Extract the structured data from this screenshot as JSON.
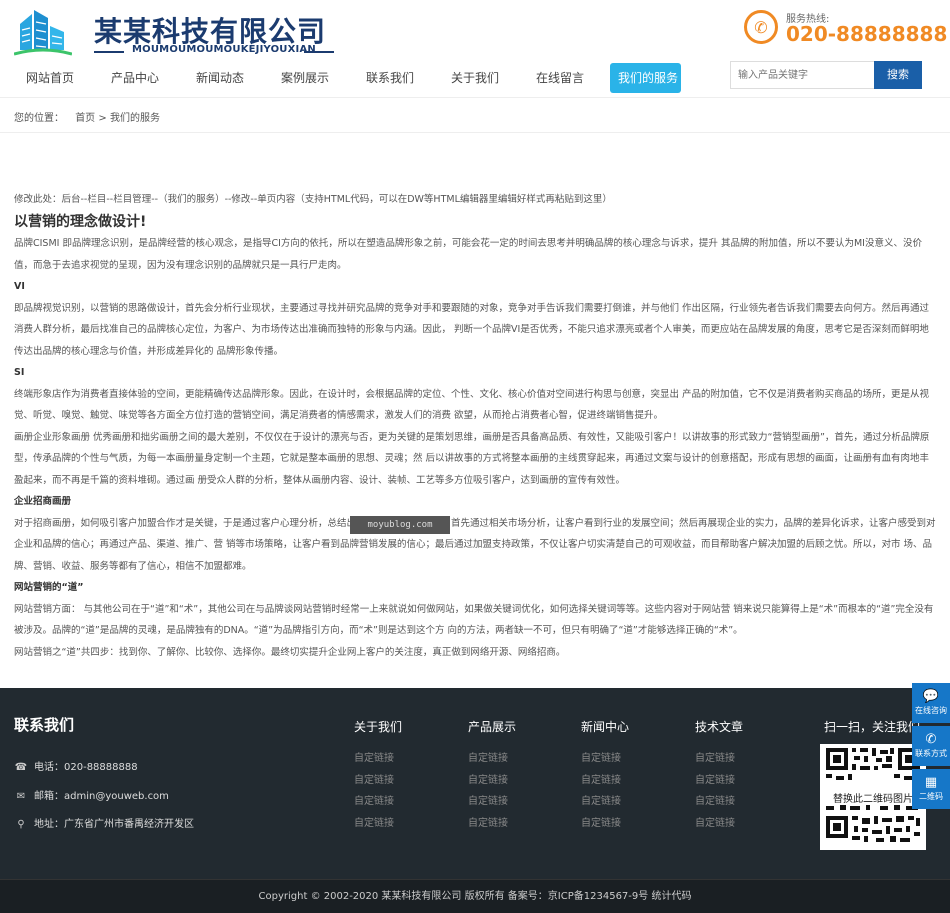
{
  "brand": {
    "title": "某某科技有限公司",
    "subtitle": "MOUMOUMOUMOUKEJIYOUXIAN",
    "logo_icon": "building-logo-icon"
  },
  "hotline": {
    "label": "服务热线:",
    "number": "020-88888888",
    "icon": "phone-icon",
    "color": "#f08a24"
  },
  "nav": {
    "items": [
      {
        "label": "网站首页"
      },
      {
        "label": "产品中心"
      },
      {
        "label": "新闻动态"
      },
      {
        "label": "案例展示"
      },
      {
        "label": "联系我们"
      },
      {
        "label": "关于我们"
      },
      {
        "label": "在线留言"
      },
      {
        "label": "我们的服务",
        "active": true
      }
    ],
    "active_color": "#2ab3e8"
  },
  "search": {
    "placeholder": "输入产品关键字",
    "button": "搜索",
    "button_color": "#1a5fa8"
  },
  "breadcrumb": {
    "prefix": "您的位置：",
    "home": "首页",
    "sep": ">",
    "current": "我们的服务"
  },
  "content": {
    "note": "修改此处：后台--栏目--栏目管理--（我们的服务）--修改--单页内容（支持HTML代码，可以在DW等HTML编辑器里编辑好样式再粘贴到这里）",
    "title": "以营销的理念做设计!",
    "p1": "品牌CISMI 即品牌理念识别，是品牌经营的核心观念，是指导CI方向的依托，所以在塑造品牌形象之前，可能会花一定的时间去思考并明确品牌的核心理念与诉求，提升 其品牌的附加值，所以不要认为MI没意义、没价值，而急于去追求视觉的呈现，因为没有理念识别的品牌就只是一具行尸走肉。",
    "h_vi": "VI",
    "p2": "即品牌视觉识别，以营销的思路做设计，首先会分析行业现状，主要通过寻找并研究品牌的竞争对手和要跟随的对象，竞争对手告诉我们需要打倒谁，并与他们 作出区隔，行业领先者告诉我们需要去向何方。然后再通过消费人群分析，最后找准自己的品牌核心定位，为客户、为市场传达出准确而独特的形象与内涵。因此， 判断一个品牌VI是否优秀，不能只追求漂亮或者个人审美，而更应站在品牌发展的角度，思考它是否深刻而鲜明地传达出品牌的核心理念与价值，并形成差异化的 品牌形象传播。",
    "h_si": "SI",
    "p3": "终端形象店作为消费者直接体验的空间，更能精确传达品牌形象。因此，在设计时，会根据品牌的定位、个性、文化、核心价值对空间进行构思与创意，突显出 产品的附加值，它不仅是消费者购买商品的场所，更是从视觉、听觉、嗅觉、触觉、味觉等各方面全方位打造的营销空间，满足消费者的情感需求，激发人们的消费 欲望，从而抢占消费者心智，促进终端销售提升。",
    "p4": "画册企业形象画册 优秀画册和拙劣画册之间的最大差别，不仅仅在于设计的漂亮与否，更为关键的是策划思维，画册是否具备高品质、有效性，又能吸引客户！以讲故事的形式致力“营销型画册”，首先，通过分析品牌原型，传承品牌的个性与气质，为每一本画册量身定制一个主题，它就是整本画册的思想、灵魂；然 后以讲故事的方式将整本画册的主线贯穿起来，再通过文案与设计的创意搭配，形成有思想的画面，让画册有血有肉地丰盈起来，而不再是千篇的资料堆砌。通过画 册受众人群的分析，整体从画册内容、设计、装帧、工艺等多方位吸引客户，达到画册的宣传有效性。",
    "h_zs": "企业招商画册",
    "p5": "对于招商画册，如何吸引客户加盟合作才是关键，于是通过客户心理分析，总结出客户加盟的几大顾虑，首先通过相关市场分析，让客户看到行业的发展空间；然后再展现企业的实力，品牌的差异化诉求，让客户感受到对企业和品牌的信心；再通过产品、渠道、推广、营 销等市场策略，让客户看到品牌营销发展的信心；最后通过加盟支持政策，不仅让客户切实清楚自己的可观收益，而目帮助客户解决加盟的后顾之忧。所以，对市 场、品牌、营销、收益、服务等都有了信心，相信不加盟都难。",
    "h_web": "网站营销的“道”",
    "p6": "网站营销方面： 与其他公司在于“道”和“术”，其他公司在与品牌谈网站营销时经常一上来就说如何做网站，如果做关键词优化，如何选择关键词等等。这些内容对于网站营 销来说只能算得上是“术”而根本的“道”完全没有被涉及。品牌的“道”是品牌的灵魂，是品牌独有的DNA。“道”为品牌指引方向，而“术”则是达到这个方 向的方法，两者缺一不可，但只有明确了“道”才能够选择正确的“术”。",
    "p7": "网站营销之“道”共四步：找到你、了解你、比较你、选择你。最终切实提升企业网上客户的关注度，真正做到网络开源、网络招商。"
  },
  "watermark": "moyublog.com",
  "footer": {
    "contact_title": "联系我们",
    "phone": "电话：020-88888888",
    "email": "邮箱：admin@youweb.com",
    "address": "地址：广东省广州市番禺经济开发区",
    "columns": [
      {
        "title": "关于我们",
        "links": [
          "自定链接",
          "自定链接",
          "自定链接",
          "自定链接"
        ]
      },
      {
        "title": "产品展示",
        "links": [
          "自定链接",
          "自定链接",
          "自定链接",
          "自定链接"
        ]
      },
      {
        "title": "新闻中心",
        "links": [
          "自定链接",
          "自定链接",
          "自定链接",
          "自定链接"
        ]
      },
      {
        "title": "技术文章",
        "links": [
          "自定链接",
          "自定链接",
          "自定链接",
          "自定链接"
        ]
      }
    ],
    "qr_title": "扫一扫，关注我们",
    "qr_caption": "替换此二维码图片",
    "copyright": "Copyright © 2002-2020 某某科技有限公司 版权所有    备案号：京ICP备1234567-9号 统计代码"
  },
  "side_bar": {
    "items": [
      {
        "label": "在线咨询",
        "icon": "chat-icon"
      },
      {
        "label": "联系方式",
        "icon": "phone-icon"
      },
      {
        "label": "二维码",
        "icon": "qrcode-icon"
      }
    ],
    "color": "#1677c8"
  }
}
